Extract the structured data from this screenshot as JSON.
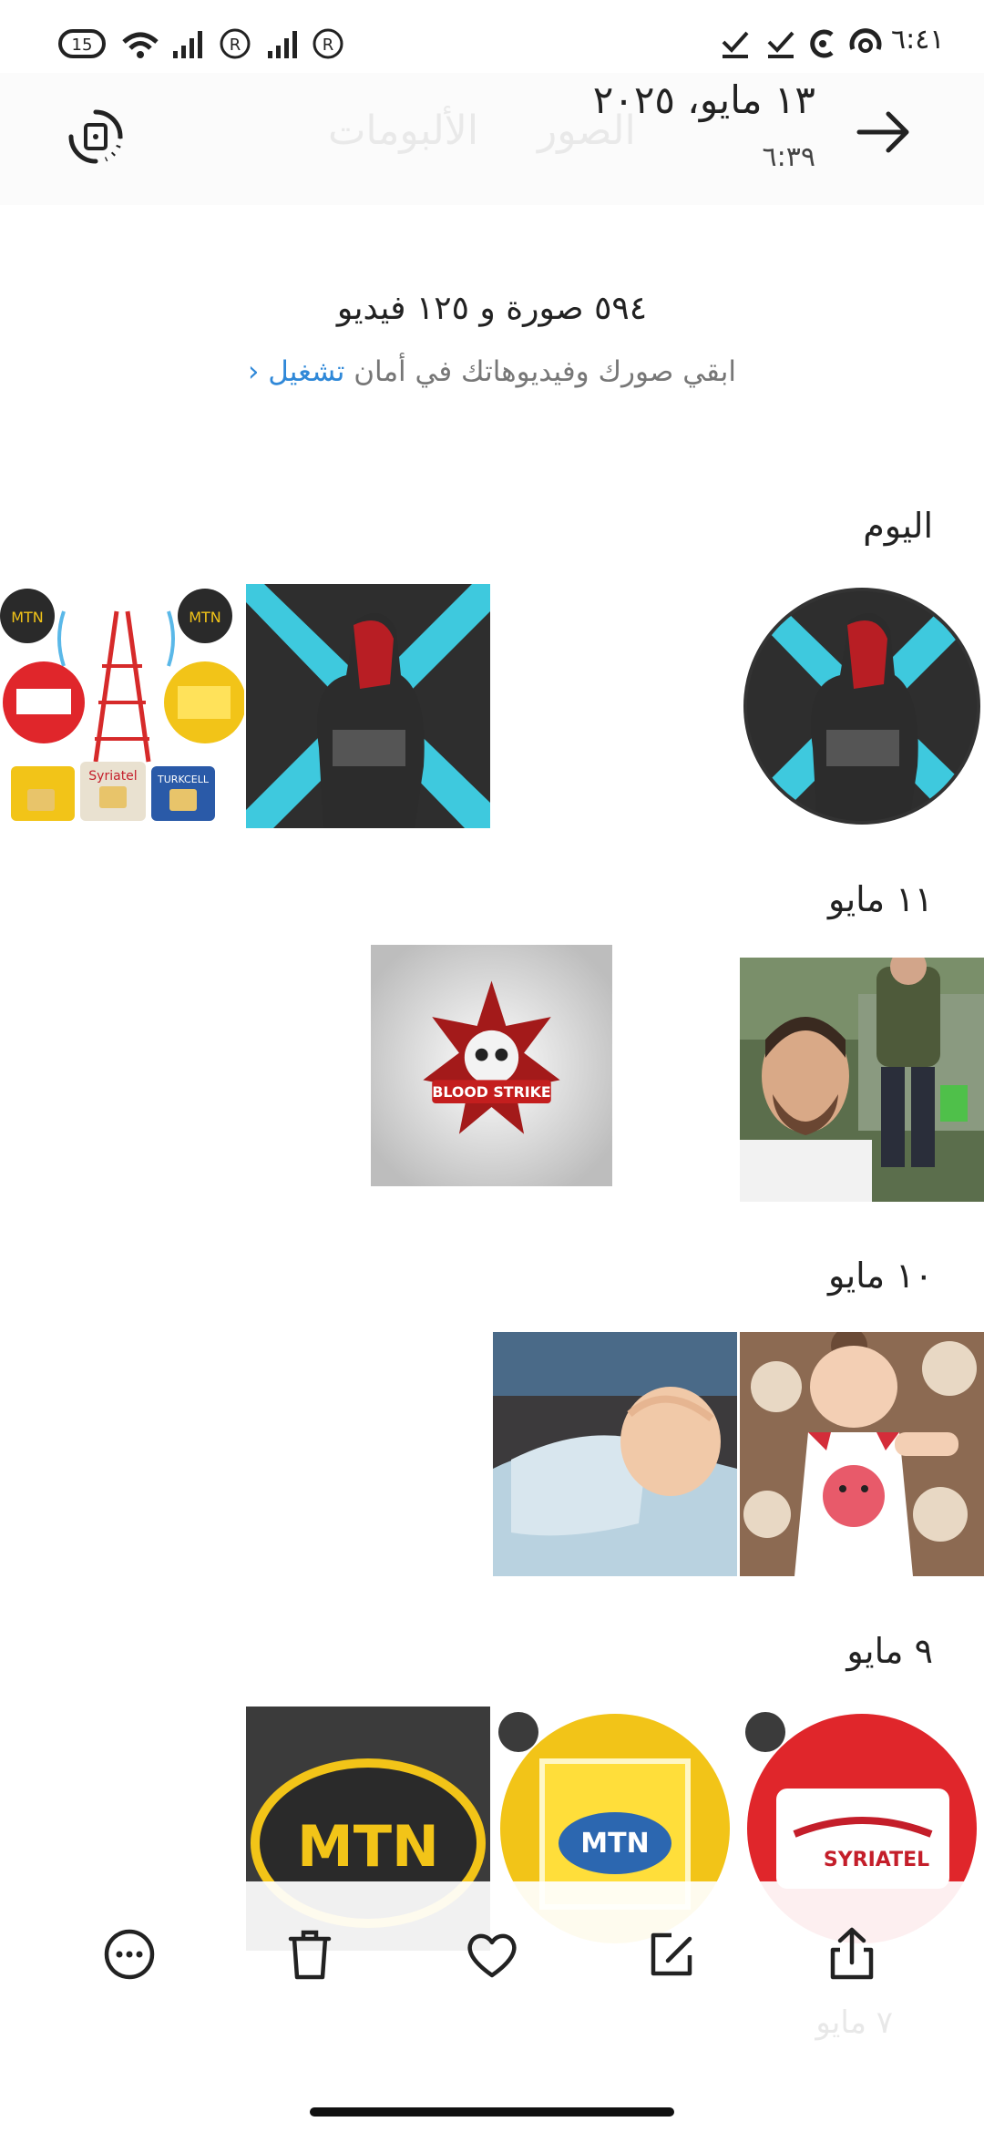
{
  "status_bar": {
    "time": "٦:٤١",
    "battery_level": "15",
    "icons": [
      "battery-icon",
      "wifi-icon",
      "signal-icon",
      "roaming-icon",
      "signal-icon",
      "roaming-icon",
      "check-icon",
      "check-icon",
      "sync-icon",
      "hotspot-icon"
    ]
  },
  "header": {
    "faded_tabs": [
      "الصور",
      "الألبومات"
    ],
    "date_title": "١٣ مايو، ٢٠٢٥",
    "time_sub": "٦:٣٩",
    "icons": [
      "arrow-right-icon",
      "rotate-icon"
    ]
  },
  "summary": {
    "counts": "٥٩٤ صورة و ١٢٥ فيديو",
    "backup_text": "ابقي صورك وفيديوهاتك في أمان",
    "backup_link": "تشغيل"
  },
  "sections": [
    {
      "label": "اليوم",
      "thumbs": [
        "operator-collage",
        "hero-character",
        "hero-character-circle"
      ]
    },
    {
      "label": "١١ مايو",
      "thumbs": [
        "blood-strike-logo",
        "selfie-photo"
      ]
    },
    {
      "label": "١٠ مايو",
      "thumbs": [
        "baby-sleeping",
        "baby-awake"
      ]
    },
    {
      "label": "٩ مايو",
      "thumbs": [
        "mtn-logo-dark",
        "mtn-logo-yellow",
        "syriatel-logo"
      ]
    }
  ],
  "faded_next_section": "٧ مايو",
  "toolbar": {
    "items": [
      "more-icon",
      "delete-icon",
      "favorite-icon",
      "edit-icon",
      "share-icon"
    ]
  },
  "colors": {
    "accent_link": "#2f88d8",
    "cyan": "#3ec9de",
    "mtn_yellow": "#f2c418",
    "syriatel_red": "#e0262b"
  }
}
